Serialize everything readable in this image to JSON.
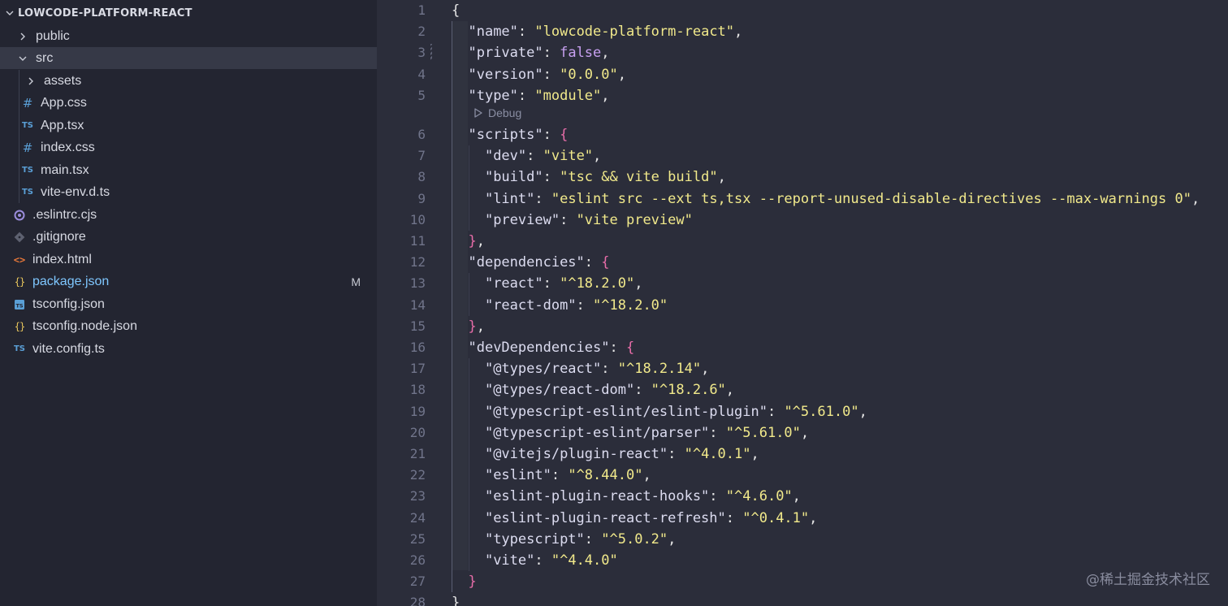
{
  "sidebar": {
    "root_label": "LOWCODE-PLATFORM-REACT",
    "items": [
      {
        "label": "public",
        "icon": "chevron-right-icon",
        "modified": false
      },
      {
        "label": "src",
        "icon": "chevron-down-icon",
        "modified": false
      },
      {
        "label": "assets",
        "icon": "chevron-right-icon",
        "modified": false
      },
      {
        "label": "App.css",
        "icon": "css-hash-icon",
        "modified": false
      },
      {
        "label": "App.tsx",
        "icon": "typescript-icon",
        "modified": false
      },
      {
        "label": "index.css",
        "icon": "css-hash-icon",
        "modified": false
      },
      {
        "label": "main.tsx",
        "icon": "typescript-icon",
        "modified": false
      },
      {
        "label": "vite-env.d.ts",
        "icon": "typescript-icon",
        "modified": false
      },
      {
        "label": ".eslintrc.cjs",
        "icon": "eslint-icon",
        "modified": false
      },
      {
        "label": ".gitignore",
        "icon": "git-icon",
        "modified": false
      },
      {
        "label": "index.html",
        "icon": "html-icon",
        "modified": false
      },
      {
        "label": "package.json",
        "icon": "json-braces-icon",
        "modified": true,
        "badge": "M"
      },
      {
        "label": "tsconfig.json",
        "icon": "tsconfig-icon",
        "modified": false
      },
      {
        "label": "tsconfig.node.json",
        "icon": "json-braces-icon",
        "modified": false
      },
      {
        "label": "vite.config.ts",
        "icon": "typescript-icon",
        "modified": false
      }
    ]
  },
  "editor": {
    "codelens": "Debug",
    "line_numbers": [
      "1",
      "2",
      "3",
      "4",
      "5",
      "6",
      "7",
      "8",
      "9",
      "10",
      "11",
      "12",
      "13",
      "14",
      "15",
      "16",
      "17",
      "18",
      "19",
      "20",
      "21",
      "22",
      "23",
      "24",
      "25",
      "26",
      "27",
      "28"
    ],
    "lines": [
      [
        {
          "t": "{",
          "c": "punct"
        }
      ],
      [
        {
          "t": "  ",
          "c": "punct"
        },
        {
          "t": "\"name\"",
          "c": "key"
        },
        {
          "t": ": ",
          "c": "punct"
        },
        {
          "t": "\"lowcode-platform-react\"",
          "c": "str"
        },
        {
          "t": ",",
          "c": "punct"
        }
      ],
      [
        {
          "t": "  ",
          "c": "punct"
        },
        {
          "t": "\"private\"",
          "c": "key"
        },
        {
          "t": ": ",
          "c": "punct"
        },
        {
          "t": "false",
          "c": "bool"
        },
        {
          "t": ",",
          "c": "punct"
        }
      ],
      [
        {
          "t": "  ",
          "c": "punct"
        },
        {
          "t": "\"version\"",
          "c": "key"
        },
        {
          "t": ": ",
          "c": "punct"
        },
        {
          "t": "\"0.0.0\"",
          "c": "str"
        },
        {
          "t": ",",
          "c": "punct"
        }
      ],
      [
        {
          "t": "  ",
          "c": "punct"
        },
        {
          "t": "\"type\"",
          "c": "key"
        },
        {
          "t": ": ",
          "c": "punct"
        },
        {
          "t": "\"module\"",
          "c": "str"
        },
        {
          "t": ",",
          "c": "punct"
        }
      ],
      [
        {
          "t": "  ",
          "c": "punct"
        },
        {
          "t": "\"scripts\"",
          "c": "key"
        },
        {
          "t": ": ",
          "c": "punct"
        },
        {
          "t": "{",
          "c": "brace"
        }
      ],
      [
        {
          "t": "    ",
          "c": "punct"
        },
        {
          "t": "\"dev\"",
          "c": "key"
        },
        {
          "t": ": ",
          "c": "punct"
        },
        {
          "t": "\"vite\"",
          "c": "str"
        },
        {
          "t": ",",
          "c": "punct"
        }
      ],
      [
        {
          "t": "    ",
          "c": "punct"
        },
        {
          "t": "\"build\"",
          "c": "key"
        },
        {
          "t": ": ",
          "c": "punct"
        },
        {
          "t": "\"tsc && vite build\"",
          "c": "str"
        },
        {
          "t": ",",
          "c": "punct"
        }
      ],
      [
        {
          "t": "    ",
          "c": "punct"
        },
        {
          "t": "\"lint\"",
          "c": "key"
        },
        {
          "t": ": ",
          "c": "punct"
        },
        {
          "t": "\"eslint src --ext ts,tsx --report-unused-disable-directives --max-warnings 0\"",
          "c": "str"
        },
        {
          "t": ",",
          "c": "punct"
        }
      ],
      [
        {
          "t": "    ",
          "c": "punct"
        },
        {
          "t": "\"preview\"",
          "c": "key"
        },
        {
          "t": ": ",
          "c": "punct"
        },
        {
          "t": "\"vite preview\"",
          "c": "str"
        }
      ],
      [
        {
          "t": "  ",
          "c": "punct"
        },
        {
          "t": "}",
          "c": "brace"
        },
        {
          "t": ",",
          "c": "punct"
        }
      ],
      [
        {
          "t": "  ",
          "c": "punct"
        },
        {
          "t": "\"dependencies\"",
          "c": "key"
        },
        {
          "t": ": ",
          "c": "punct"
        },
        {
          "t": "{",
          "c": "brace"
        }
      ],
      [
        {
          "t": "    ",
          "c": "punct"
        },
        {
          "t": "\"react\"",
          "c": "key"
        },
        {
          "t": ": ",
          "c": "punct"
        },
        {
          "t": "\"^18.2.0\"",
          "c": "str"
        },
        {
          "t": ",",
          "c": "punct"
        }
      ],
      [
        {
          "t": "    ",
          "c": "punct"
        },
        {
          "t": "\"react-dom\"",
          "c": "key"
        },
        {
          "t": ": ",
          "c": "punct"
        },
        {
          "t": "\"^18.2.0\"",
          "c": "str"
        }
      ],
      [
        {
          "t": "  ",
          "c": "punct"
        },
        {
          "t": "}",
          "c": "brace"
        },
        {
          "t": ",",
          "c": "punct"
        }
      ],
      [
        {
          "t": "  ",
          "c": "punct"
        },
        {
          "t": "\"devDependencies\"",
          "c": "key"
        },
        {
          "t": ": ",
          "c": "punct"
        },
        {
          "t": "{",
          "c": "brace"
        }
      ],
      [
        {
          "t": "    ",
          "c": "punct"
        },
        {
          "t": "\"@types/react\"",
          "c": "key"
        },
        {
          "t": ": ",
          "c": "punct"
        },
        {
          "t": "\"^18.2.14\"",
          "c": "str"
        },
        {
          "t": ",",
          "c": "punct"
        }
      ],
      [
        {
          "t": "    ",
          "c": "punct"
        },
        {
          "t": "\"@types/react-dom\"",
          "c": "key"
        },
        {
          "t": ": ",
          "c": "punct"
        },
        {
          "t": "\"^18.2.6\"",
          "c": "str"
        },
        {
          "t": ",",
          "c": "punct"
        }
      ],
      [
        {
          "t": "    ",
          "c": "punct"
        },
        {
          "t": "\"@typescript-eslint/eslint-plugin\"",
          "c": "key"
        },
        {
          "t": ": ",
          "c": "punct"
        },
        {
          "t": "\"^5.61.0\"",
          "c": "str"
        },
        {
          "t": ",",
          "c": "punct"
        }
      ],
      [
        {
          "t": "    ",
          "c": "punct"
        },
        {
          "t": "\"@typescript-eslint/parser\"",
          "c": "key"
        },
        {
          "t": ": ",
          "c": "punct"
        },
        {
          "t": "\"^5.61.0\"",
          "c": "str"
        },
        {
          "t": ",",
          "c": "punct"
        }
      ],
      [
        {
          "t": "    ",
          "c": "punct"
        },
        {
          "t": "\"@vitejs/plugin-react\"",
          "c": "key"
        },
        {
          "t": ": ",
          "c": "punct"
        },
        {
          "t": "\"^4.0.1\"",
          "c": "str"
        },
        {
          "t": ",",
          "c": "punct"
        }
      ],
      [
        {
          "t": "    ",
          "c": "punct"
        },
        {
          "t": "\"eslint\"",
          "c": "key"
        },
        {
          "t": ": ",
          "c": "punct"
        },
        {
          "t": "\"^8.44.0\"",
          "c": "str"
        },
        {
          "t": ",",
          "c": "punct"
        }
      ],
      [
        {
          "t": "    ",
          "c": "punct"
        },
        {
          "t": "\"eslint-plugin-react-hooks\"",
          "c": "key"
        },
        {
          "t": ": ",
          "c": "punct"
        },
        {
          "t": "\"^4.6.0\"",
          "c": "str"
        },
        {
          "t": ",",
          "c": "punct"
        }
      ],
      [
        {
          "t": "    ",
          "c": "punct"
        },
        {
          "t": "\"eslint-plugin-react-refresh\"",
          "c": "key"
        },
        {
          "t": ": ",
          "c": "punct"
        },
        {
          "t": "\"^0.4.1\"",
          "c": "str"
        },
        {
          "t": ",",
          "c": "punct"
        }
      ],
      [
        {
          "t": "    ",
          "c": "punct"
        },
        {
          "t": "\"typescript\"",
          "c": "key"
        },
        {
          "t": ": ",
          "c": "punct"
        },
        {
          "t": "\"^5.0.2\"",
          "c": "str"
        },
        {
          "t": ",",
          "c": "punct"
        }
      ],
      [
        {
          "t": "    ",
          "c": "punct"
        },
        {
          "t": "\"vite\"",
          "c": "key"
        },
        {
          "t": ": ",
          "c": "punct"
        },
        {
          "t": "\"^4.4.0\"",
          "c": "str"
        }
      ],
      [
        {
          "t": "  ",
          "c": "punct"
        },
        {
          "t": "}",
          "c": "brace"
        }
      ],
      [
        {
          "t": "}",
          "c": "punct"
        }
      ]
    ]
  },
  "watermark": "@稀土掘金技术社区",
  "colors": {
    "key": "#dcdcf0",
    "string": "#f1e98b",
    "boolean": "#c7a0f0",
    "brace": "#e86da9",
    "modified_file": "#7fc7ff",
    "ts_icon": "#5a9fd6",
    "json_icon": "#e7c55c",
    "html_icon": "#e5773a"
  }
}
